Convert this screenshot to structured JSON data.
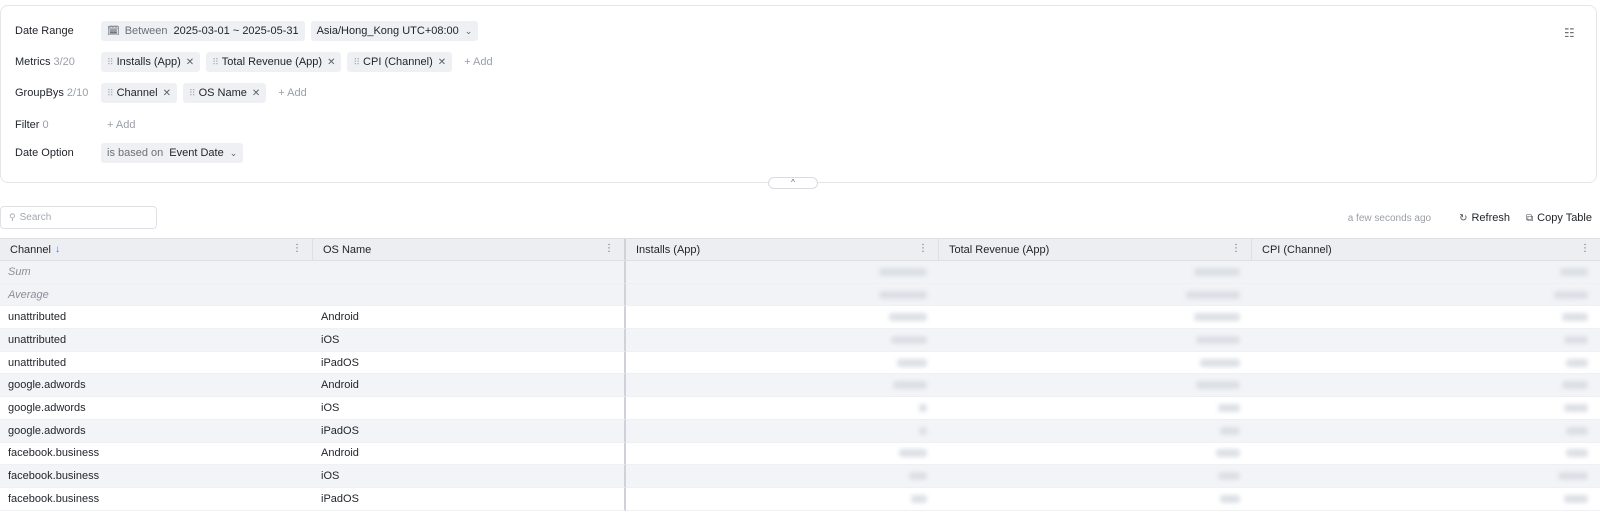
{
  "query": {
    "date_range": {
      "label": "Date Range",
      "mode": "Between",
      "value": "2025-03-01 ~ 2025-05-31",
      "timezone": "Asia/Hong_Kong UTC+08:00"
    },
    "metrics": {
      "label": "Metrics",
      "count": "3/20",
      "items": [
        "Installs (App)",
        "Total Revenue (App)",
        "CPI (Channel)"
      ],
      "add_label": "+ Add"
    },
    "groupbys": {
      "label": "GroupBys",
      "count": "2/10",
      "items": [
        "Channel",
        "OS Name"
      ],
      "add_label": "+ Add"
    },
    "filter": {
      "label": "Filter",
      "count": "0",
      "add_label": "+ Add"
    },
    "date_option": {
      "label": "Date Option",
      "prefix": "is based on",
      "value": "Event Date"
    },
    "collapse_glyph": "^"
  },
  "toolbar": {
    "search_placeholder": "Search",
    "updated_text": "a few seconds ago",
    "refresh_label": "Refresh",
    "copy_label": "Copy Table"
  },
  "table": {
    "columns": [
      "Channel",
      "OS Name",
      "Installs (App)",
      "Total Revenue (App)",
      "CPI (Channel)"
    ],
    "sort_indicator": "↓",
    "aggregates": [
      "Sum",
      "Average"
    ],
    "rows": [
      [
        "unattributed",
        "Android"
      ],
      [
        "unattributed",
        "iOS"
      ],
      [
        "unattributed",
        "iPadOS"
      ],
      [
        "google.adwords",
        "Android"
      ],
      [
        "google.adwords",
        "iOS"
      ],
      [
        "google.adwords",
        "iPadOS"
      ],
      [
        "facebook.business",
        "Android"
      ],
      [
        "facebook.business",
        "iOS"
      ],
      [
        "facebook.business",
        "iPadOS"
      ]
    ]
  }
}
